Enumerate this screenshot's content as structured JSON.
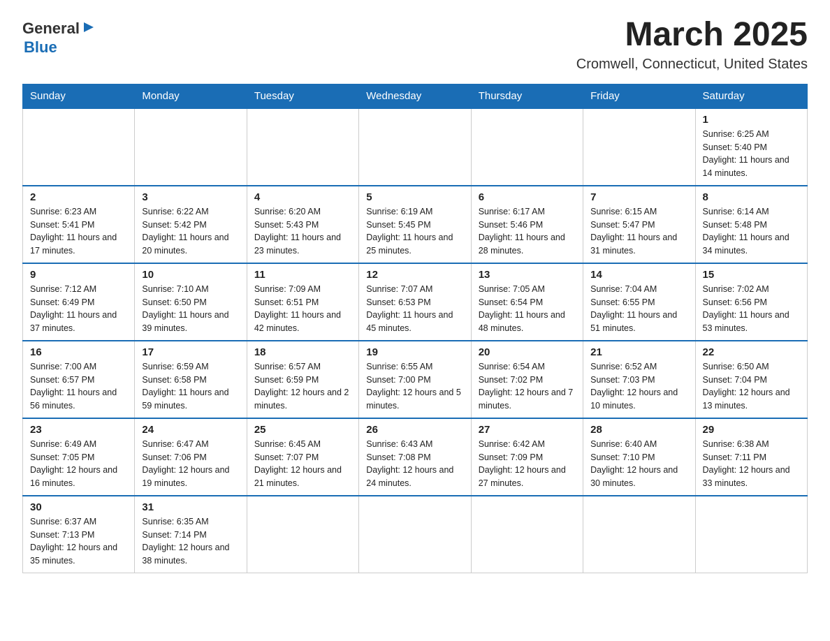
{
  "logo": {
    "general": "General",
    "arrow_symbol": "▶",
    "blue": "Blue"
  },
  "title": "March 2025",
  "subtitle": "Cromwell, Connecticut, United States",
  "days_of_week": [
    "Sunday",
    "Monday",
    "Tuesday",
    "Wednesday",
    "Thursday",
    "Friday",
    "Saturday"
  ],
  "weeks": [
    [
      {
        "day": "",
        "info": ""
      },
      {
        "day": "",
        "info": ""
      },
      {
        "day": "",
        "info": ""
      },
      {
        "day": "",
        "info": ""
      },
      {
        "day": "",
        "info": ""
      },
      {
        "day": "",
        "info": ""
      },
      {
        "day": "1",
        "info": "Sunrise: 6:25 AM\nSunset: 5:40 PM\nDaylight: 11 hours and 14 minutes."
      }
    ],
    [
      {
        "day": "2",
        "info": "Sunrise: 6:23 AM\nSunset: 5:41 PM\nDaylight: 11 hours and 17 minutes."
      },
      {
        "day": "3",
        "info": "Sunrise: 6:22 AM\nSunset: 5:42 PM\nDaylight: 11 hours and 20 minutes."
      },
      {
        "day": "4",
        "info": "Sunrise: 6:20 AM\nSunset: 5:43 PM\nDaylight: 11 hours and 23 minutes."
      },
      {
        "day": "5",
        "info": "Sunrise: 6:19 AM\nSunset: 5:45 PM\nDaylight: 11 hours and 25 minutes."
      },
      {
        "day": "6",
        "info": "Sunrise: 6:17 AM\nSunset: 5:46 PM\nDaylight: 11 hours and 28 minutes."
      },
      {
        "day": "7",
        "info": "Sunrise: 6:15 AM\nSunset: 5:47 PM\nDaylight: 11 hours and 31 minutes."
      },
      {
        "day": "8",
        "info": "Sunrise: 6:14 AM\nSunset: 5:48 PM\nDaylight: 11 hours and 34 minutes."
      }
    ],
    [
      {
        "day": "9",
        "info": "Sunrise: 7:12 AM\nSunset: 6:49 PM\nDaylight: 11 hours and 37 minutes."
      },
      {
        "day": "10",
        "info": "Sunrise: 7:10 AM\nSunset: 6:50 PM\nDaylight: 11 hours and 39 minutes."
      },
      {
        "day": "11",
        "info": "Sunrise: 7:09 AM\nSunset: 6:51 PM\nDaylight: 11 hours and 42 minutes."
      },
      {
        "day": "12",
        "info": "Sunrise: 7:07 AM\nSunset: 6:53 PM\nDaylight: 11 hours and 45 minutes."
      },
      {
        "day": "13",
        "info": "Sunrise: 7:05 AM\nSunset: 6:54 PM\nDaylight: 11 hours and 48 minutes."
      },
      {
        "day": "14",
        "info": "Sunrise: 7:04 AM\nSunset: 6:55 PM\nDaylight: 11 hours and 51 minutes."
      },
      {
        "day": "15",
        "info": "Sunrise: 7:02 AM\nSunset: 6:56 PM\nDaylight: 11 hours and 53 minutes."
      }
    ],
    [
      {
        "day": "16",
        "info": "Sunrise: 7:00 AM\nSunset: 6:57 PM\nDaylight: 11 hours and 56 minutes."
      },
      {
        "day": "17",
        "info": "Sunrise: 6:59 AM\nSunset: 6:58 PM\nDaylight: 11 hours and 59 minutes."
      },
      {
        "day": "18",
        "info": "Sunrise: 6:57 AM\nSunset: 6:59 PM\nDaylight: 12 hours and 2 minutes."
      },
      {
        "day": "19",
        "info": "Sunrise: 6:55 AM\nSunset: 7:00 PM\nDaylight: 12 hours and 5 minutes."
      },
      {
        "day": "20",
        "info": "Sunrise: 6:54 AM\nSunset: 7:02 PM\nDaylight: 12 hours and 7 minutes."
      },
      {
        "day": "21",
        "info": "Sunrise: 6:52 AM\nSunset: 7:03 PM\nDaylight: 12 hours and 10 minutes."
      },
      {
        "day": "22",
        "info": "Sunrise: 6:50 AM\nSunset: 7:04 PM\nDaylight: 12 hours and 13 minutes."
      }
    ],
    [
      {
        "day": "23",
        "info": "Sunrise: 6:49 AM\nSunset: 7:05 PM\nDaylight: 12 hours and 16 minutes."
      },
      {
        "day": "24",
        "info": "Sunrise: 6:47 AM\nSunset: 7:06 PM\nDaylight: 12 hours and 19 minutes."
      },
      {
        "day": "25",
        "info": "Sunrise: 6:45 AM\nSunset: 7:07 PM\nDaylight: 12 hours and 21 minutes."
      },
      {
        "day": "26",
        "info": "Sunrise: 6:43 AM\nSunset: 7:08 PM\nDaylight: 12 hours and 24 minutes."
      },
      {
        "day": "27",
        "info": "Sunrise: 6:42 AM\nSunset: 7:09 PM\nDaylight: 12 hours and 27 minutes."
      },
      {
        "day": "28",
        "info": "Sunrise: 6:40 AM\nSunset: 7:10 PM\nDaylight: 12 hours and 30 minutes."
      },
      {
        "day": "29",
        "info": "Sunrise: 6:38 AM\nSunset: 7:11 PM\nDaylight: 12 hours and 33 minutes."
      }
    ],
    [
      {
        "day": "30",
        "info": "Sunrise: 6:37 AM\nSunset: 7:13 PM\nDaylight: 12 hours and 35 minutes."
      },
      {
        "day": "31",
        "info": "Sunrise: 6:35 AM\nSunset: 7:14 PM\nDaylight: 12 hours and 38 minutes."
      },
      {
        "day": "",
        "info": ""
      },
      {
        "day": "",
        "info": ""
      },
      {
        "day": "",
        "info": ""
      },
      {
        "day": "",
        "info": ""
      },
      {
        "day": "",
        "info": ""
      }
    ]
  ]
}
